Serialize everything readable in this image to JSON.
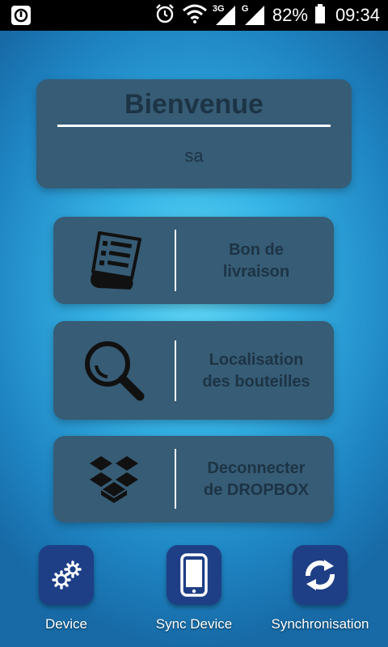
{
  "status_bar": {
    "network_1": "3G",
    "network_2": "G",
    "battery": "82%",
    "time": "09:34",
    "icons": [
      "notification-icon",
      "alarm-icon",
      "wifi-icon",
      "signal-icon",
      "battery-icon"
    ]
  },
  "welcome": {
    "title": "Bienvenue",
    "user": "sa"
  },
  "menu": {
    "delivery_label_1": "Bon de",
    "delivery_label_2": "livraison",
    "locate_label_1": "Localisation",
    "locate_label_2": "des bouteilles",
    "dropbox_label_1": "Deconnecter",
    "dropbox_label_2": "de DROPBOX"
  },
  "bottom_nav": {
    "device": "Device",
    "sync_device": "Sync Device",
    "synchronisation": "Synchronisation"
  },
  "colors": {
    "card": "#375c75",
    "card_text": "#1c3445",
    "nav_tile": "#1e3f86"
  }
}
